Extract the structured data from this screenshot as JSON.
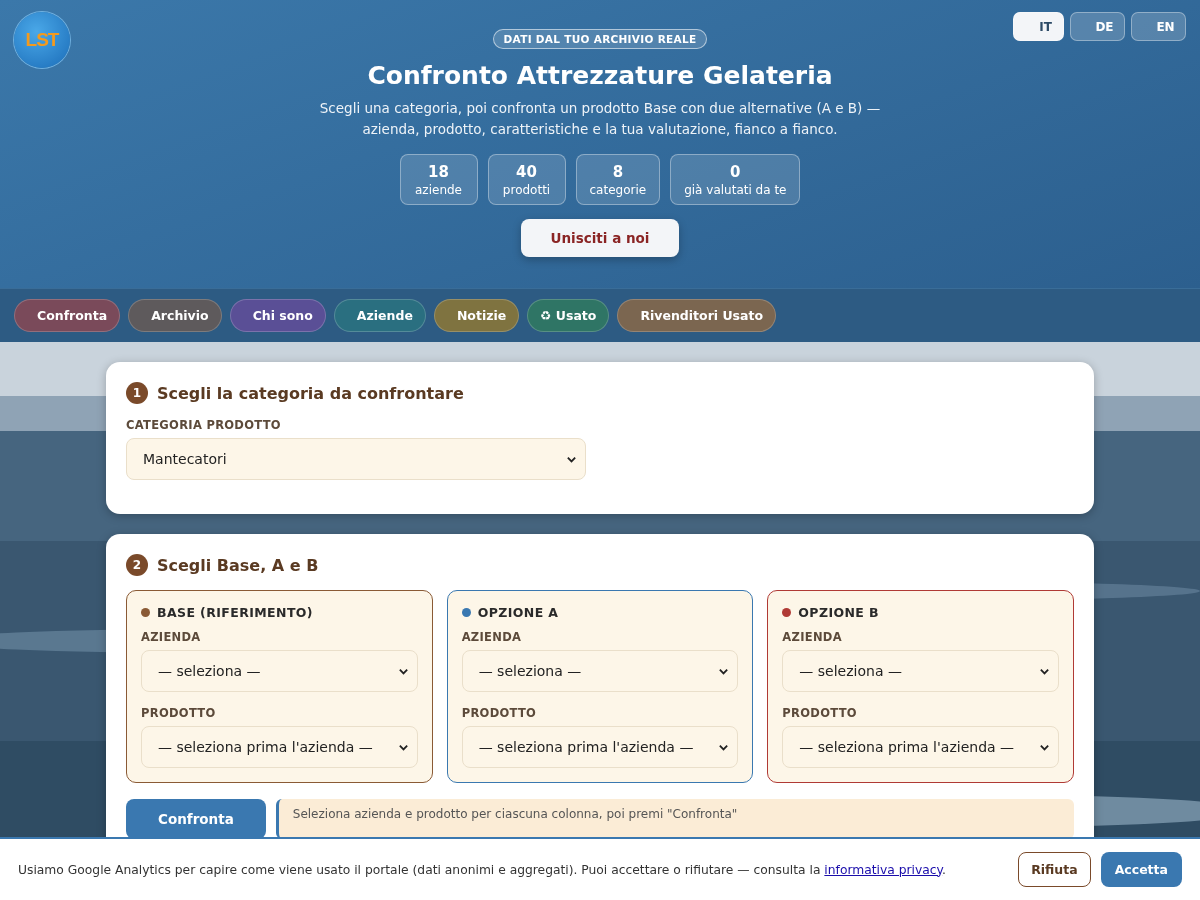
{
  "logo": {
    "text": "LST"
  },
  "languages": [
    {
      "label": "IT",
      "selected": true
    },
    {
      "label": "DE",
      "selected": false
    },
    {
      "label": "EN",
      "selected": false
    }
  ],
  "header": {
    "badge": "DATI DAL TUO ARCHIVIO REALE",
    "title": "Confronto Attrezzature Gelateria",
    "subtitle": "Scegli una categoria, poi confronta un prodotto Base con due alternative (A e B) — azienda, prodotto, caratteristiche e la tua valutazione, fianco a fianco.",
    "stats": [
      {
        "value": "18",
        "label": "aziende"
      },
      {
        "value": "40",
        "label": "prodotti"
      },
      {
        "value": "8",
        "label": "categorie"
      },
      {
        "value": "0",
        "label": "già valutati da te"
      }
    ],
    "join_button": "Unisciti a noi"
  },
  "nav": [
    {
      "label": "Confronta",
      "color": "#7a4a5a"
    },
    {
      "label": "Archivio",
      "color": "#5e5a5c"
    },
    {
      "label": "Chi sono",
      "color": "#5a4f96"
    },
    {
      "label": "Aziende",
      "color": "#2a6f80"
    },
    {
      "label": "Notizie",
      "color": "#7f7340"
    },
    {
      "icon": "♻",
      "label": "Usato",
      "color": "#2f7565"
    },
    {
      "label": "Rivenditori Usato",
      "color": "#7b6650"
    }
  ],
  "step1": {
    "number": "1",
    "title": "Scegli la categoria da confrontare",
    "field_label": "CATEGORIA PRODOTTO",
    "value": "Mantecatori"
  },
  "step2": {
    "number": "2",
    "title": "Scegli Base, A e B",
    "columns": [
      {
        "title": "BASE (RIFERIMENTO)",
        "color": "#8a5a35",
        "company_label": "AZIENDA",
        "company_value": "— seleziona —",
        "product_label": "PRODOTTO",
        "product_value": "— seleziona prima l'azienda —"
      },
      {
        "title": "OPZIONE A",
        "color": "#3a78b0",
        "company_label": "AZIENDA",
        "company_value": "— seleziona —",
        "product_label": "PRODOTTO",
        "product_value": "— seleziona prima l'azienda —"
      },
      {
        "title": "OPZIONE B",
        "color": "#b03a35",
        "company_label": "AZIENDA",
        "company_value": "— seleziona —",
        "product_label": "PRODOTTO",
        "product_value": "— seleziona prima l'azienda —"
      }
    ],
    "compare_button": "Confronta",
    "hint": "Seleziona azienda e prodotto per ciascuna colonna, poi premi \"Confronta\""
  },
  "cookie_banner": {
    "text": "Usiamo Google Analytics per capire come viene usato il portale (dati anonimi e aggregati). Puoi accettare o rifiutare — consulta la",
    "link": "informativa privacy",
    "end": ".",
    "reject": "Rifiuta",
    "accept": "Accetta"
  }
}
